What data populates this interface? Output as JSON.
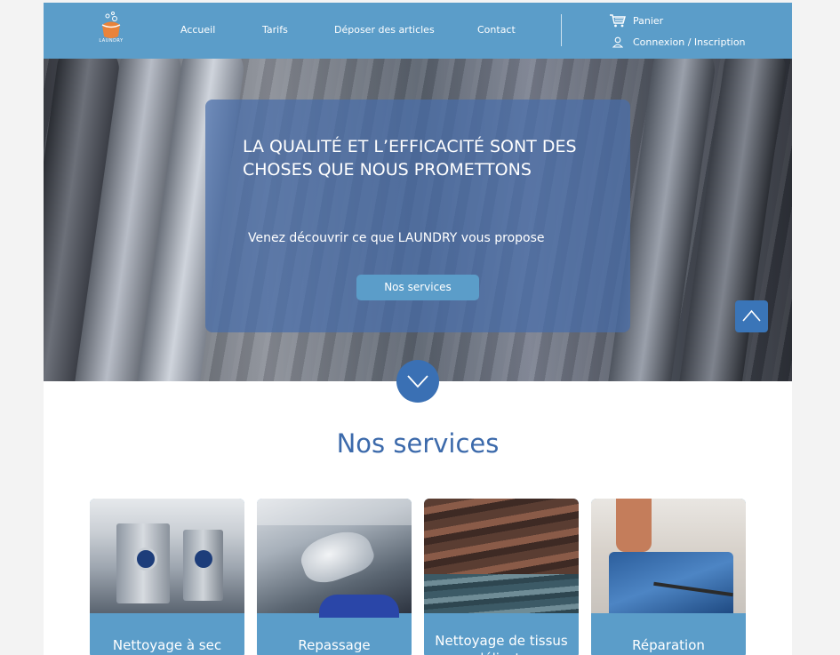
{
  "brand": {
    "logo_text": "LAUNDRY"
  },
  "nav": {
    "items": [
      "Accueil",
      "Tarifs",
      "Déposer des articles",
      "Contact"
    ]
  },
  "util": {
    "cart": "Panier",
    "account": "Connexion / Inscription"
  },
  "hero": {
    "title": "LA QUALITÉ ET L’EFFICACITÉ SONT DES CHOSES QUE NOUS PROMETTONS",
    "subtitle": "Venez découvrir ce que LAUNDRY vous propose",
    "button": "Nos services"
  },
  "services": {
    "title": "Nos services",
    "cards": [
      {
        "label": "Nettoyage à sec"
      },
      {
        "label": "Repassage"
      },
      {
        "label": "Nettoyage de tissus délicats"
      },
      {
        "label": "Réparation"
      }
    ]
  },
  "colors": {
    "header": "#5b9dc9",
    "accent": "#3a70b4",
    "title": "#3c6aab"
  },
  "icons": [
    "logo-icon",
    "cart-icon",
    "user-icon",
    "chevron-up-icon",
    "chevron-down-icon"
  ]
}
